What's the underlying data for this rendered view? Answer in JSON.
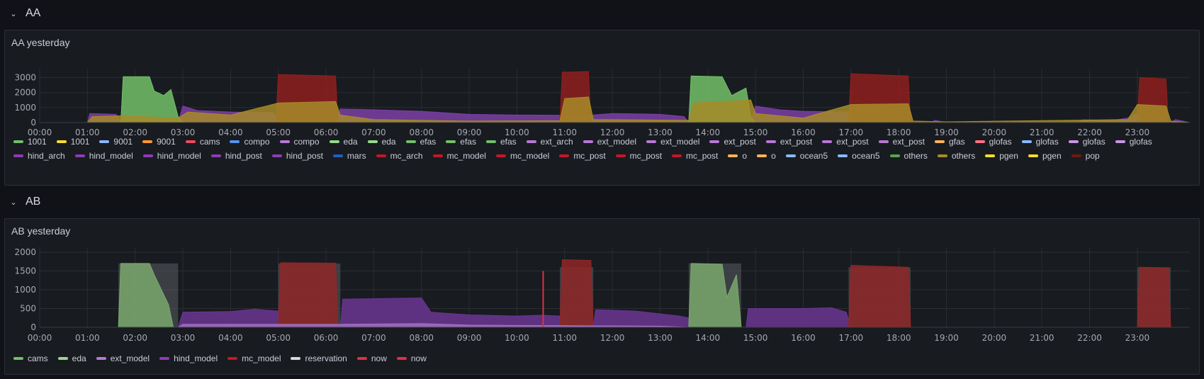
{
  "rows": [
    {
      "title": "AA",
      "panel_title": "AA yesterday"
    },
    {
      "title": "AB",
      "panel_title": "AB yesterday"
    }
  ],
  "chart_data": [
    {
      "type": "area",
      "title": "AA yesterday",
      "x_ticks": [
        "00:00",
        "01:00",
        "02:00",
        "03:00",
        "04:00",
        "05:00",
        "06:00",
        "07:00",
        "08:00",
        "09:00",
        "10:00",
        "11:00",
        "12:00",
        "13:00",
        "14:00",
        "15:00",
        "16:00",
        "17:00",
        "18:00",
        "19:00",
        "20:00",
        "21:00",
        "22:00",
        "23:00"
      ],
      "y_ticks": [
        0,
        1000,
        2000,
        3000
      ],
      "ylim": [
        0,
        3300
      ],
      "xlim_hours": [
        0,
        24.1
      ],
      "grid": true,
      "stacked": true,
      "legend_position": "bottom",
      "series": [
        {
          "name": "hind_model",
          "color": "#7b3fa6",
          "points": [
            [
              1.0,
              0
            ],
            [
              1.05,
              600
            ],
            [
              1.6,
              550
            ],
            [
              1.7,
              0
            ],
            [
              2.9,
              0
            ],
            [
              3.0,
              1100
            ],
            [
              3.3,
              800
            ],
            [
              4.0,
              700
            ],
            [
              4.9,
              650
            ],
            [
              5.0,
              0
            ],
            [
              6.2,
              0
            ],
            [
              6.3,
              900
            ],
            [
              7.0,
              850
            ],
            [
              8.0,
              750
            ],
            [
              9.0,
              550
            ],
            [
              10.0,
              500
            ],
            [
              11.5,
              480
            ],
            [
              12.0,
              600
            ],
            [
              13.0,
              550
            ],
            [
              13.5,
              400
            ],
            [
              13.6,
              0
            ],
            [
              14.9,
              0
            ],
            [
              15.0,
              1100
            ],
            [
              15.5,
              850
            ],
            [
              16.0,
              750
            ],
            [
              17.0,
              700
            ],
            [
              17.05,
              0
            ],
            [
              18.7,
              0
            ],
            [
              18.75,
              150
            ],
            [
              19.0,
              0
            ],
            [
              19.8,
              0
            ],
            [
              19.85,
              60
            ],
            [
              20.0,
              0
            ],
            [
              21.8,
              0
            ],
            [
              21.85,
              180
            ],
            [
              22.5,
              150
            ],
            [
              22.8,
              300
            ],
            [
              23.0,
              600
            ],
            [
              23.1,
              0
            ],
            [
              23.7,
              0
            ],
            [
              23.8,
              200
            ],
            [
              24.1,
              0
            ]
          ]
        },
        {
          "name": "efas",
          "color": "#73bf69",
          "points": [
            [
              1.7,
              0
            ],
            [
              1.75,
              3050
            ],
            [
              2.3,
              3050
            ],
            [
              2.4,
              2100
            ],
            [
              2.6,
              1800
            ],
            [
              2.75,
              2200
            ],
            [
              2.9,
              400
            ],
            [
              3.0,
              0
            ],
            [
              13.6,
              0
            ],
            [
              13.65,
              3100
            ],
            [
              14.3,
              3050
            ],
            [
              14.5,
              1800
            ],
            [
              14.8,
              2300
            ],
            [
              14.9,
              400
            ],
            [
              15.0,
              0
            ]
          ]
        },
        {
          "name": "mc_model",
          "color": "#8f1f1f",
          "points": [
            [
              4.95,
              0
            ],
            [
              5.0,
              3200
            ],
            [
              6.2,
              3100
            ],
            [
              6.25,
              0
            ],
            [
              10.9,
              0
            ],
            [
              10.95,
              3350
            ],
            [
              11.5,
              3400
            ],
            [
              11.55,
              0
            ],
            [
              16.95,
              0
            ],
            [
              17.0,
              3250
            ],
            [
              18.2,
              3100
            ],
            [
              18.25,
              0
            ],
            [
              23.0,
              0
            ],
            [
              23.05,
              3000
            ],
            [
              23.6,
              2900
            ],
            [
              23.65,
              0
            ]
          ]
        },
        {
          "name": "others",
          "color": "#a68b28",
          "points": [
            [
              1.0,
              0
            ],
            [
              1.1,
              400
            ],
            [
              1.7,
              450
            ],
            [
              2.9,
              300
            ],
            [
              3.1,
              700
            ],
            [
              4.0,
              500
            ],
            [
              5.0,
              1300
            ],
            [
              6.2,
              1400
            ],
            [
              6.3,
              500
            ],
            [
              7.0,
              200
            ],
            [
              8.0,
              150
            ],
            [
              9.0,
              100
            ],
            [
              10.9,
              120
            ],
            [
              11.0,
              1600
            ],
            [
              11.5,
              1700
            ],
            [
              11.6,
              200
            ],
            [
              13.6,
              150
            ],
            [
              13.7,
              1300
            ],
            [
              14.9,
              1500
            ],
            [
              15.0,
              600
            ],
            [
              16.0,
              300
            ],
            [
              17.0,
              1200
            ],
            [
              18.2,
              1250
            ],
            [
              18.3,
              100
            ],
            [
              19.0,
              50
            ],
            [
              22.8,
              200
            ],
            [
              23.0,
              1200
            ],
            [
              23.6,
              1100
            ],
            [
              23.7,
              100
            ],
            [
              24.1,
              0
            ]
          ]
        }
      ],
      "legend": [
        {
          "name": "1001",
          "color": "#73bf69"
        },
        {
          "name": "1001",
          "color": "#fade2a"
        },
        {
          "name": "9001",
          "color": "#8ab8ff"
        },
        {
          "name": "9001",
          "color": "#ff9830"
        },
        {
          "name": "cams",
          "color": "#f2495c"
        },
        {
          "name": "compo",
          "color": "#5794f2"
        },
        {
          "name": "compo",
          "color": "#b877d9"
        },
        {
          "name": "eda",
          "color": "#96d98d"
        },
        {
          "name": "eda",
          "color": "#96d98d"
        },
        {
          "name": "efas",
          "color": "#73bf69"
        },
        {
          "name": "efas",
          "color": "#73bf69"
        },
        {
          "name": "efas",
          "color": "#73bf69"
        },
        {
          "name": "ext_arch",
          "color": "#b877d9"
        },
        {
          "name": "ext_model",
          "color": "#b877d9"
        },
        {
          "name": "ext_model",
          "color": "#b877d9"
        },
        {
          "name": "ext_post",
          "color": "#b877d9"
        },
        {
          "name": "ext_post",
          "color": "#b877d9"
        },
        {
          "name": "ext_post",
          "color": "#b877d9"
        },
        {
          "name": "ext_post",
          "color": "#b877d9"
        },
        {
          "name": "gfas",
          "color": "#ffb357"
        },
        {
          "name": "glofas",
          "color": "#ff7383"
        },
        {
          "name": "glofas",
          "color": "#8ab8ff"
        },
        {
          "name": "glofas",
          "color": "#ca95e5"
        },
        {
          "name": "glofas",
          "color": "#ca95e5"
        },
        {
          "name": "hind_arch",
          "color": "#8f3bb8"
        },
        {
          "name": "hind_model",
          "color": "#8f3bb8"
        },
        {
          "name": "hind_model",
          "color": "#8f3bb8"
        },
        {
          "name": "hind_post",
          "color": "#8f3bb8"
        },
        {
          "name": "hind_post",
          "color": "#8f3bb8"
        },
        {
          "name": "mars",
          "color": "#1f60c4"
        },
        {
          "name": "mc_arch",
          "color": "#c4162a"
        },
        {
          "name": "mc_model",
          "color": "#c4162a"
        },
        {
          "name": "mc_model",
          "color": "#c4162a"
        },
        {
          "name": "mc_post",
          "color": "#c4162a"
        },
        {
          "name": "mc_post",
          "color": "#c4162a"
        },
        {
          "name": "mc_post",
          "color": "#c4162a"
        },
        {
          "name": "o",
          "color": "#ffb357"
        },
        {
          "name": "o",
          "color": "#ffb357"
        },
        {
          "name": "ocean5",
          "color": "#8ab8ff"
        },
        {
          "name": "ocean5",
          "color": "#8ab8ff"
        },
        {
          "name": "others",
          "color": "#56a64b"
        },
        {
          "name": "others",
          "color": "#a68b28"
        },
        {
          "name": "pgen",
          "color": "#fade2a"
        },
        {
          "name": "pgen",
          "color": "#fade2a"
        },
        {
          "name": "pop",
          "color": "#6e1a10"
        }
      ]
    },
    {
      "type": "area",
      "title": "AB yesterday",
      "x_ticks": [
        "00:00",
        "01:00",
        "02:00",
        "03:00",
        "04:00",
        "05:00",
        "06:00",
        "07:00",
        "08:00",
        "09:00",
        "10:00",
        "11:00",
        "12:00",
        "13:00",
        "14:00",
        "15:00",
        "16:00",
        "17:00",
        "18:00",
        "19:00",
        "20:00",
        "21:00",
        "22:00",
        "23:00"
      ],
      "y_ticks": [
        0,
        500,
        1000,
        1500,
        2000
      ],
      "ylim": [
        0,
        2000
      ],
      "xlim_hours": [
        0,
        24.1
      ],
      "grid": true,
      "stacked": false,
      "legend_position": "bottom",
      "reservations": [
        [
          1.65,
          2.9,
          1700
        ],
        [
          5.0,
          6.3,
          1700
        ],
        [
          10.9,
          11.6,
          1600
        ],
        [
          13.6,
          14.7,
          1700
        ],
        [
          16.95,
          18.25,
          1600
        ],
        [
          23.0,
          23.7,
          1600
        ]
      ],
      "now_line": {
        "x": 10.55,
        "y": 1500
      },
      "series": [
        {
          "name": "hind_model",
          "color": "#6b3593",
          "points": [
            [
              2.9,
              0
            ],
            [
              3.0,
              400
            ],
            [
              4.0,
              420
            ],
            [
              4.5,
              480
            ],
            [
              5.0,
              430
            ],
            [
              5.0,
              0
            ],
            [
              6.3,
              0
            ],
            [
              6.35,
              750
            ],
            [
              8.0,
              780
            ],
            [
              8.2,
              400
            ],
            [
              9.0,
              330
            ],
            [
              10.0,
              300
            ],
            [
              10.5,
              320
            ],
            [
              10.9,
              300
            ],
            [
              10.9,
              0
            ],
            [
              11.6,
              0
            ],
            [
              11.65,
              470
            ],
            [
              12.5,
              430
            ],
            [
              13.4,
              300
            ],
            [
              13.6,
              250
            ],
            [
              13.6,
              0
            ],
            [
              14.8,
              0
            ],
            [
              14.85,
              500
            ],
            [
              16.0,
              500
            ],
            [
              16.6,
              520
            ],
            [
              16.9,
              400
            ],
            [
              17.0,
              0
            ]
          ]
        },
        {
          "name": "mc_model",
          "color": "#8f2727",
          "points": [
            [
              5.0,
              0
            ],
            [
              5.05,
              1720
            ],
            [
              6.2,
              1710
            ],
            [
              6.25,
              0
            ],
            [
              10.9,
              0
            ],
            [
              10.95,
              1800
            ],
            [
              11.55,
              1780
            ],
            [
              11.6,
              0
            ],
            [
              16.95,
              0
            ],
            [
              17.0,
              1650
            ],
            [
              18.2,
              1600
            ],
            [
              18.25,
              0
            ],
            [
              23.0,
              0
            ],
            [
              23.05,
              1600
            ],
            [
              23.65,
              1580
            ],
            [
              23.7,
              0
            ]
          ]
        },
        {
          "name": "eda",
          "color": "#7aa86c",
          "points": [
            [
              1.65,
              0
            ],
            [
              1.7,
              1700
            ],
            [
              2.3,
              1700
            ],
            [
              2.4,
              1400
            ],
            [
              2.7,
              600
            ],
            [
              2.8,
              0
            ],
            [
              13.6,
              0
            ],
            [
              13.65,
              1700
            ],
            [
              14.3,
              1680
            ],
            [
              14.4,
              800
            ],
            [
              14.6,
              1400
            ],
            [
              14.7,
              0
            ]
          ]
        },
        {
          "name": "ext_model",
          "color": "#a070c0",
          "points": [
            [
              2.9,
              0
            ],
            [
              3.0,
              80
            ],
            [
              5.0,
              80
            ],
            [
              6.3,
              80
            ],
            [
              8.0,
              100
            ],
            [
              9.0,
              60
            ],
            [
              10.0,
              50
            ],
            [
              11.6,
              40
            ],
            [
              13.0,
              30
            ],
            [
              13.6,
              0
            ]
          ]
        }
      ],
      "legend": [
        {
          "name": "cams",
          "color": "#73bf69"
        },
        {
          "name": "eda",
          "color": "#96d98d"
        },
        {
          "name": "ext_model",
          "color": "#b877d9"
        },
        {
          "name": "hind_model",
          "color": "#8f3bb8"
        },
        {
          "name": "mc_model",
          "color": "#c4162a"
        },
        {
          "name": "reservation",
          "color": "#d8d9da"
        },
        {
          "name": "now",
          "color": "#e02f44"
        },
        {
          "name": "now",
          "color": "#e02f44"
        }
      ]
    }
  ]
}
